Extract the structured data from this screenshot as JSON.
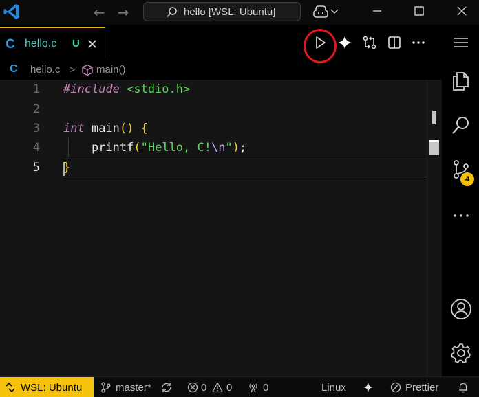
{
  "titlebar": {
    "search_text": "hello [WSL: Ubuntu]",
    "back_glyph": "←",
    "forward_glyph": "→"
  },
  "tab": {
    "lang_icon": "C",
    "name": "hello.c",
    "status": "U"
  },
  "breadcrumb": {
    "lang_icon": "C",
    "file": "hello.c",
    "separator": ">",
    "symbol": "main()"
  },
  "editor": {
    "line_numbers": [
      "1",
      "2",
      "3",
      "4",
      "5"
    ],
    "active_line": "5",
    "code": {
      "l1_pre": "#include",
      "l1_inc": " <stdio.h>",
      "l3_kw": "int",
      "l3_fn": " main",
      "l3_par": "()",
      "l3_space": " ",
      "l3_br": "{",
      "l4_indent": "    ",
      "l4_fn": "printf",
      "l4_par_open": "(",
      "l4_str_a": "\"Hello, C!",
      "l4_esc": "\\n",
      "l4_str_b": "\"",
      "l4_par_close": ")",
      "l4_semi": ";",
      "l5_br": "}"
    }
  },
  "activity": {
    "scm_badge": "4"
  },
  "statusbar": {
    "remote": "WSL: Ubuntu",
    "branch": "master*",
    "errors": "0",
    "warnings": "0",
    "ports": "0",
    "language": "Linux",
    "formatter": "Prettier"
  },
  "colors": {
    "accent": "#f4c20d",
    "highlight_ring": "#e0171c",
    "c_icon": "#1d9bf0",
    "tab_text": "#3bd6c6"
  },
  "icons": [
    "vscode-logo-icon",
    "search-icon",
    "copilot-icon",
    "chevron-down-icon",
    "minimize-icon",
    "maximize-icon",
    "close-icon",
    "run-icon",
    "sparkle-icon",
    "compare-changes-icon",
    "split-editor-icon",
    "more-actions-icon",
    "menu-icon",
    "explorer-icon",
    "search-view-icon",
    "source-control-icon",
    "accounts-icon",
    "settings-gear-icon",
    "cube-symbol-icon",
    "remote-icon",
    "branch-icon",
    "sync-icon",
    "error-icon",
    "warning-icon",
    "ports-icon",
    "copilot-status-icon",
    "prettier-icon",
    "bell-icon"
  ]
}
